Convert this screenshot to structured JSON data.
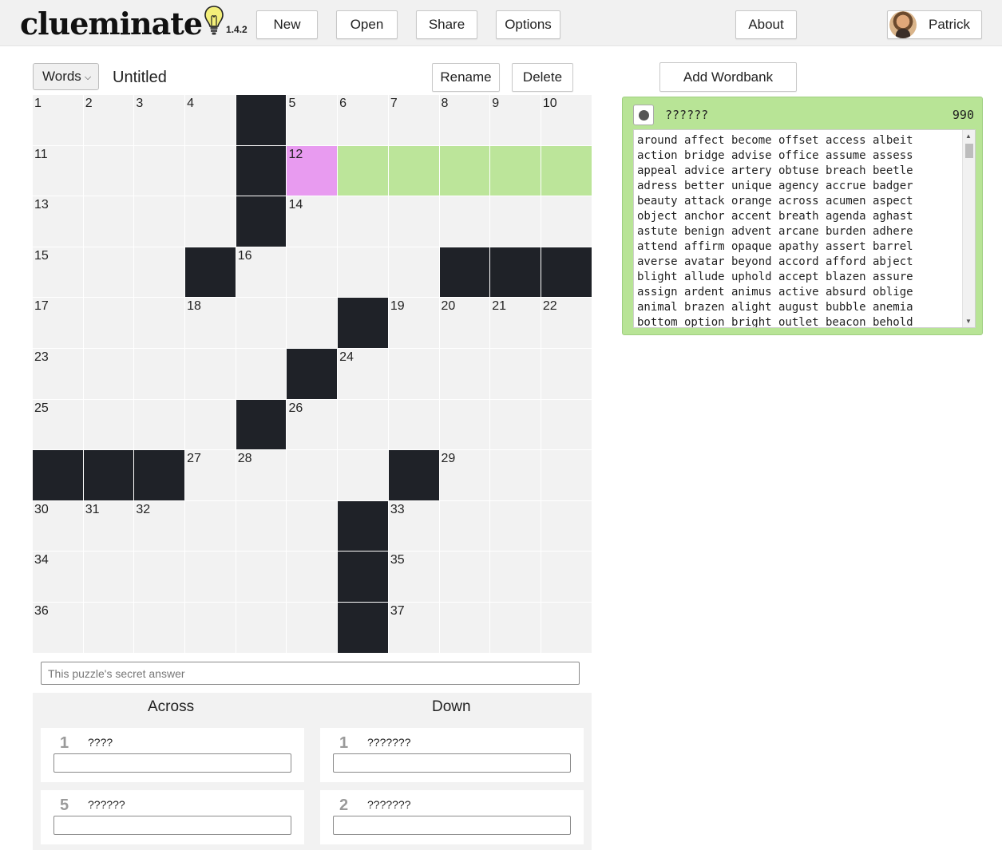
{
  "app": {
    "logo": "clueminate",
    "version": "1.4.2"
  },
  "nav": {
    "new": "New",
    "open": "Open",
    "share": "Share",
    "options": "Options",
    "about": "About",
    "user": "Patrick"
  },
  "puzzle": {
    "mode": "Words",
    "title": "Untitled",
    "rename": "Rename",
    "delete": "Delete",
    "secret_placeholder": "This puzzle's secret answer"
  },
  "grid": {
    "size": 11,
    "rows": [
      [
        "1",
        "2",
        "3",
        "4",
        "#",
        "5",
        "6",
        "7",
        "8",
        "9",
        "10"
      ],
      [
        "11",
        "",
        "",
        "",
        "#",
        "12",
        "",
        "",
        "",
        "",
        ""
      ],
      [
        "13",
        "",
        "",
        "",
        "#",
        "14",
        "",
        "",
        "",
        "",
        ""
      ],
      [
        "15",
        "",
        "",
        "#",
        "16",
        "",
        "",
        "",
        "#",
        "#",
        "#"
      ],
      [
        "17",
        "",
        "",
        "18",
        "",
        "",
        "#",
        "19",
        "20",
        "21",
        "22"
      ],
      [
        "23",
        "",
        "",
        "",
        "",
        "#",
        "24",
        "",
        "",
        "",
        ""
      ],
      [
        "25",
        "",
        "",
        "",
        "#",
        "26",
        "",
        "",
        "",
        "",
        ""
      ],
      [
        "#",
        "#",
        "#",
        "27",
        "28",
        "",
        "",
        "#",
        "29",
        "",
        ""
      ],
      [
        "30",
        "31",
        "32",
        "",
        "",
        "",
        "#",
        "33",
        "",
        "",
        ""
      ],
      [
        "34",
        "",
        "",
        "",
        "",
        "",
        "#",
        "35",
        "",
        "",
        ""
      ],
      [
        "36",
        "",
        "",
        "",
        "",
        "",
        "#",
        "37",
        "",
        "",
        ""
      ]
    ],
    "selected": [
      [
        1,
        5
      ]
    ],
    "highlighted": [
      [
        1,
        6
      ],
      [
        1,
        7
      ],
      [
        1,
        8
      ],
      [
        1,
        9
      ],
      [
        1,
        10
      ]
    ]
  },
  "clues": {
    "across_label": "Across",
    "down_label": "Down",
    "across": [
      {
        "num": "1",
        "pattern": "????"
      },
      {
        "num": "5",
        "pattern": "??????"
      }
    ],
    "down": [
      {
        "num": "1",
        "pattern": "???????"
      },
      {
        "num": "2",
        "pattern": "???????"
      }
    ]
  },
  "wordbank": {
    "add_label": "Add Wordbank",
    "pattern": "??????",
    "count": "990",
    "words": "around affect become offset access albeit\naction bridge advise office assume assess\nappeal advice artery obtuse breach beetle\nadress better unique agency accrue badger\nbeauty attack orange across acumen aspect\nobject anchor accent breath agenda aghast\nastute benign advent arcane burden adhere\nattend affirm opaque apathy assert barrel\naverse avatar beyond accord afford abject\nblight allude uphold accept blazen assure\nassign ardent animus active absurd oblige\nanimal brazen alight august bubble anemia\nbottom option bright outlet beacon behold"
  },
  "colors": {
    "selected_cell": "#e89bf0",
    "highlighted_cell": "#bce59a",
    "black_cell": "#1f2228",
    "wordbank_bg": "#b8e496"
  }
}
